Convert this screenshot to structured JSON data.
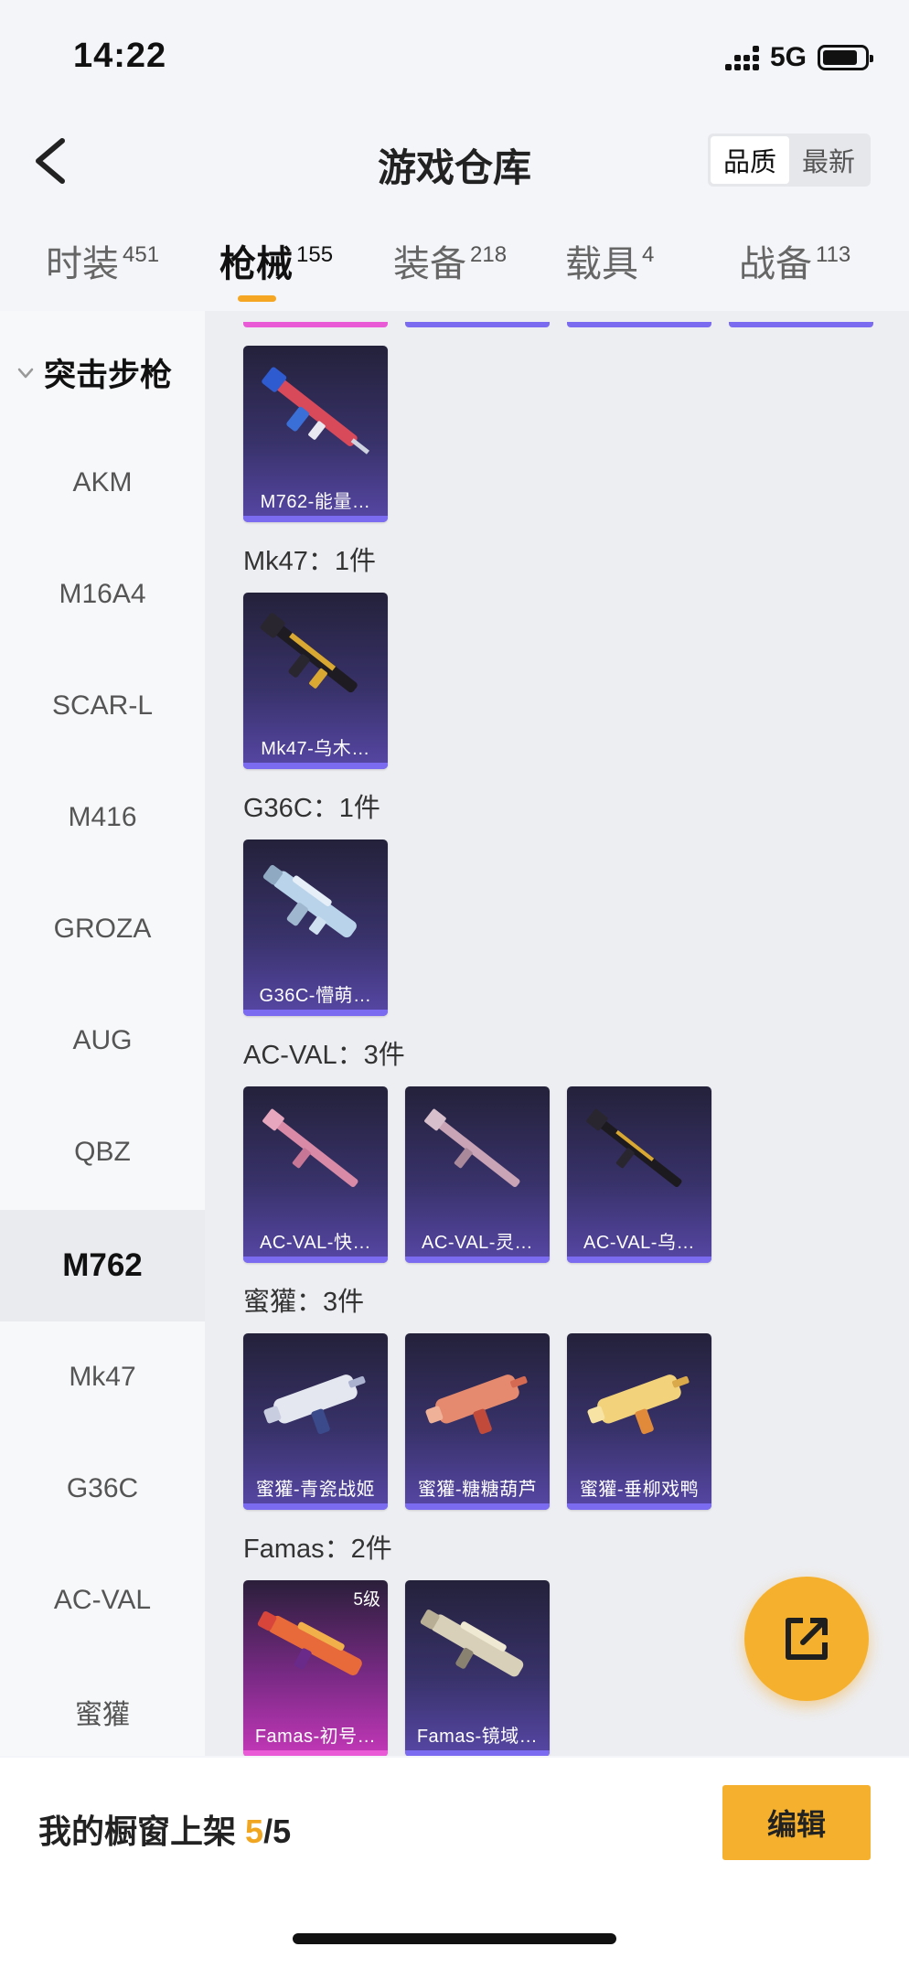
{
  "status": {
    "time": "14:22",
    "network": "5G"
  },
  "header": {
    "title": "游戏仓库",
    "sort_options": [
      "品质",
      "最新"
    ]
  },
  "tabs": [
    {
      "label": "时装",
      "count": "451"
    },
    {
      "label": "枪械",
      "count": "155"
    },
    {
      "label": "装备",
      "count": "218"
    },
    {
      "label": "载具",
      "count": "4"
    },
    {
      "label": "战备",
      "count": "113"
    }
  ],
  "sidebar": {
    "group": "突击步枪",
    "items": [
      "AKM",
      "M16A4",
      "SCAR-L",
      "M416",
      "GROZA",
      "AUG",
      "QBZ",
      "M762",
      "Mk47",
      "G36C",
      "AC-VAL",
      "蜜獾"
    ],
    "active": "M762"
  },
  "content": {
    "top_cards": [
      {
        "label": "M762-能量…"
      }
    ],
    "sections": [
      {
        "title": "Mk47：1件",
        "cards": [
          {
            "label": "Mk47-乌木…"
          }
        ]
      },
      {
        "title": "G36C：1件",
        "cards": [
          {
            "label": "G36C-懵萌…"
          }
        ]
      },
      {
        "title": "AC-VAL：3件",
        "cards": [
          {
            "label": "AC-VAL-快…"
          },
          {
            "label": "AC-VAL-灵…"
          },
          {
            "label": "AC-VAL-乌…"
          }
        ]
      },
      {
        "title": "蜜獾：3件",
        "cards": [
          {
            "label": "蜜獾-青瓷战姬"
          },
          {
            "label": "蜜獾-糖糖葫芦"
          },
          {
            "label": "蜜獾-垂柳戏鸭"
          }
        ]
      },
      {
        "title": "Famas：2件",
        "cards": [
          {
            "label": "Famas-初号…",
            "level": "5级"
          },
          {
            "label": "Famas-镜域…"
          }
        ]
      }
    ]
  },
  "bottom": {
    "showcase_label": "我的橱窗上架",
    "showcase_current": "5",
    "showcase_total": "/5",
    "edit_label": "编辑"
  },
  "colors": {
    "accent": "#f5a623",
    "card_purple": "#5747a6",
    "card_pink": "#c437b8"
  }
}
